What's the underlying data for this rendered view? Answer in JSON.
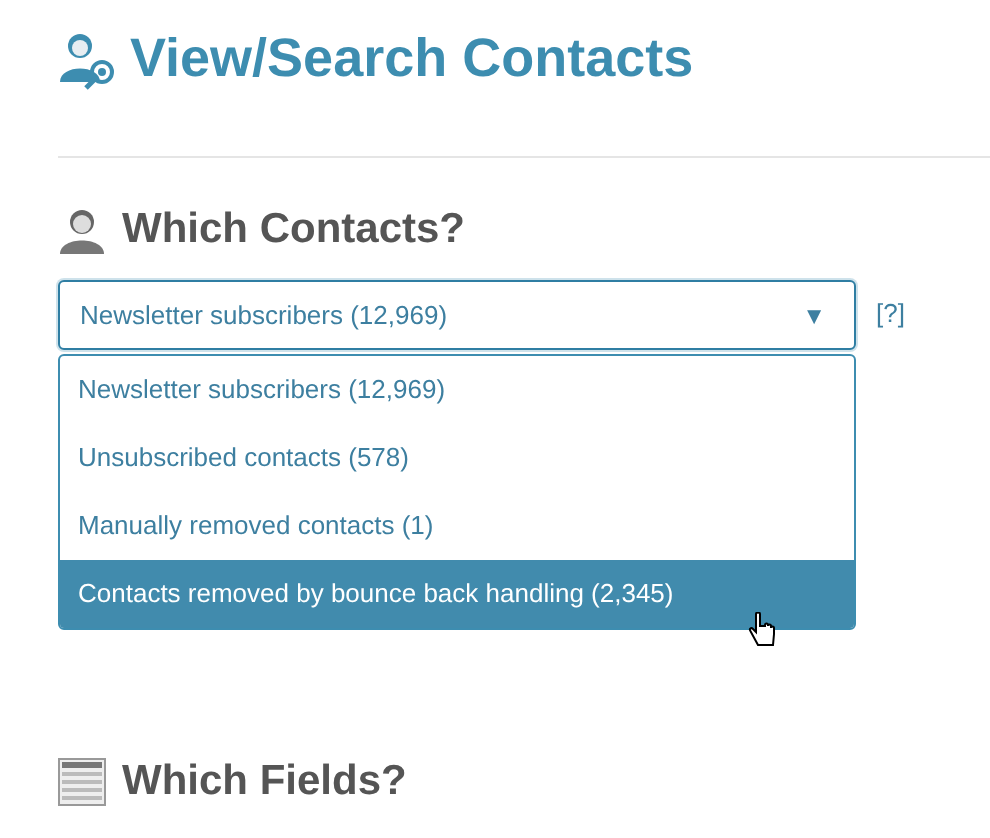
{
  "title": "View/Search Contacts",
  "contacts_section": {
    "heading": "Which Contacts?",
    "select": {
      "value": "Newsletter subscribers (12,969)",
      "arrow": "▼",
      "expanded": true
    },
    "help": "[?]",
    "options": [
      {
        "label": "Newsletter subscribers (12,969)",
        "selected": false
      },
      {
        "label": "Unsubscribed contacts (578)",
        "selected": false
      },
      {
        "label": "Manually removed contacts (1)",
        "selected": false
      },
      {
        "label": "Contacts removed by bounce back handling (2,345)",
        "selected": true
      }
    ]
  },
  "fields_section": {
    "heading": "Which Fields?"
  }
}
